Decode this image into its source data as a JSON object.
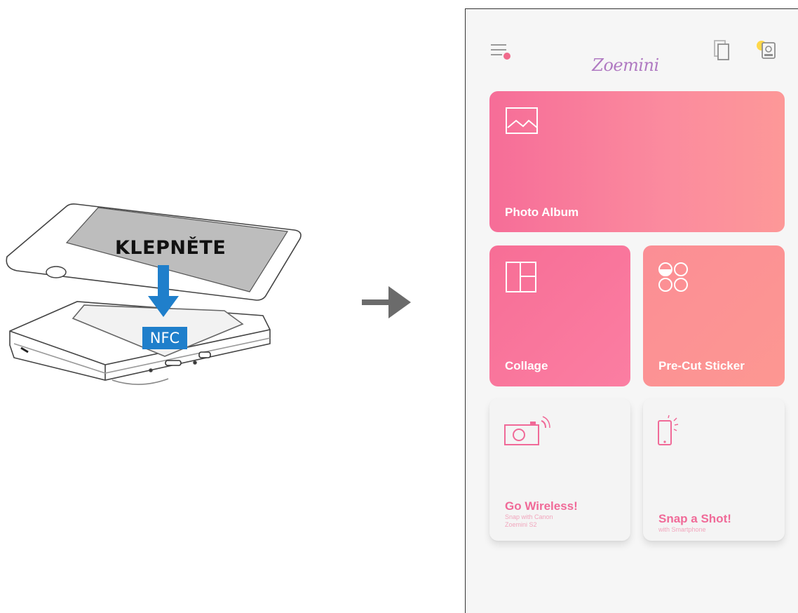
{
  "illustration": {
    "tap_label": "KLEPNĚTE",
    "nfc_label": "NFC"
  },
  "app": {
    "title": "Zoemini"
  },
  "tiles": {
    "photo_album": {
      "label": "Photo Album"
    },
    "collage": {
      "label": "Collage"
    },
    "sticker": {
      "label": "Pre-Cut Sticker"
    },
    "wireless": {
      "label": "Go Wireless!",
      "sub1": "Snap with Canon",
      "sub2": "Zoemini S2"
    },
    "snap": {
      "label": "Snap a Shot!",
      "sub1": "with Smartphone"
    }
  },
  "colors": {
    "accent_pink": "#f66d98",
    "nfc_blue": "#1f7fcb",
    "title_purple": "#b07ac2"
  },
  "icons": {
    "menu": "menu-icon",
    "pages": "copies-icon",
    "printer": "printer-icon",
    "flow": "right-arrow-icon"
  }
}
